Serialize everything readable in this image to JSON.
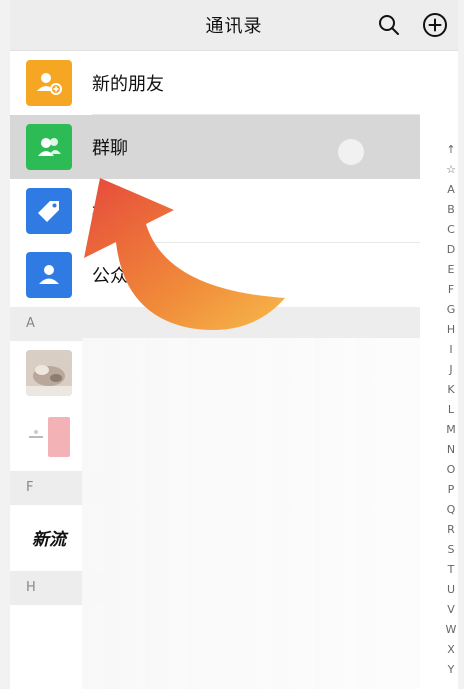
{
  "header": {
    "title": "通讯录"
  },
  "list": {
    "new_friends": "新的朋友",
    "group_chat": "群聊",
    "tags": "标",
    "official_accounts": "公众"
  },
  "sections": {
    "a": "A",
    "f": "F",
    "h": "H"
  },
  "contacts": {
    "f_contact_avatar_text": "新流"
  },
  "index_bar": [
    "↑",
    "☆",
    "A",
    "B",
    "C",
    "D",
    "E",
    "F",
    "G",
    "H",
    "I",
    "J",
    "K",
    "L",
    "M",
    "N",
    "O",
    "P",
    "Q",
    "R",
    "S",
    "T",
    "U",
    "V",
    "W",
    "X",
    "Y"
  ],
  "colors": {
    "orange": "#f5a623",
    "green": "#2dbb55",
    "blue": "#2f7be3",
    "arrow_start": "#e74c3c",
    "arrow_end": "#f7b733"
  }
}
